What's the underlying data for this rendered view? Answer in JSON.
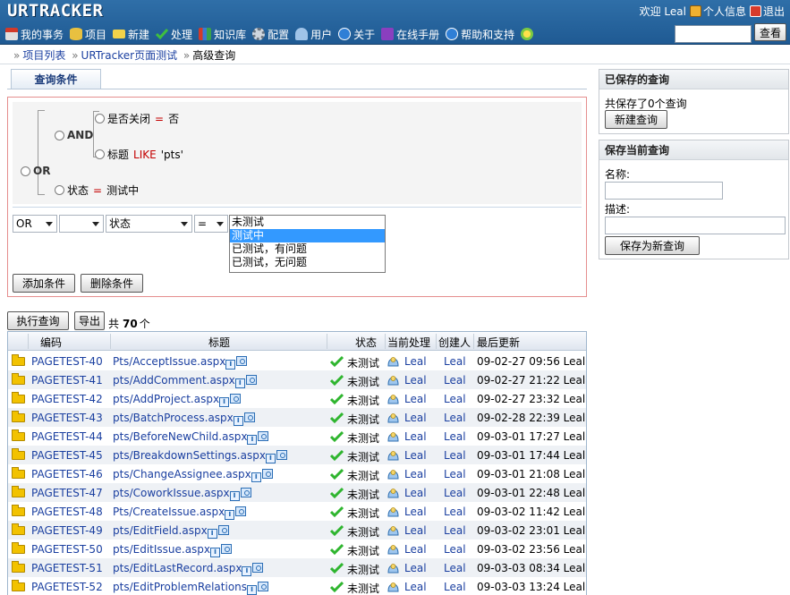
{
  "app": {
    "logo": "URTRACKER",
    "welcome": "欢迎 Leal",
    "profile_label": "个人信息",
    "logout_label": "退出"
  },
  "nav": [
    {
      "label": "我的事务",
      "icon": "home-icon"
    },
    {
      "label": "项目",
      "icon": "database-icon"
    },
    {
      "label": "新建",
      "icon": "new-icon"
    },
    {
      "label": "处理",
      "icon": "check-icon"
    },
    {
      "label": "知识库",
      "icon": "books-icon"
    },
    {
      "label": "配置",
      "icon": "gear-icon"
    },
    {
      "label": "用户",
      "icon": "users-icon"
    },
    {
      "label": "关于",
      "icon": "info-icon"
    },
    {
      "label": "在线手册",
      "icon": "book-icon"
    },
    {
      "label": "帮助和支持",
      "icon": "help-icon"
    }
  ],
  "search": {
    "value": "",
    "button": "查看"
  },
  "breadcrumb": [
    "项目列表",
    "URTracker页面测试",
    "高级查询"
  ],
  "tab_label": "查询条件",
  "tree": {
    "or_label": "OR",
    "and_label": "AND",
    "cond1": {
      "field": "是否关闭",
      "op": "=",
      "value": "否"
    },
    "cond2": {
      "field": "标题",
      "op": "LIKE",
      "value": "'pts'"
    },
    "cond3": {
      "field": "状态",
      "op": "=",
      "value": "测试中"
    }
  },
  "builder": {
    "logic": "OR",
    "bracket": "",
    "field": "状态",
    "operator": "=",
    "options": [
      "未测试",
      "测试中",
      "已测试，有问题",
      "已测试，无问题"
    ],
    "selected_index": 1,
    "add_button": "添加条件",
    "delete_button": "删除条件"
  },
  "saved": {
    "title": "已保存的查询",
    "summary": "共保存了0个查询",
    "new_button": "新建查询"
  },
  "save_current": {
    "title": "保存当前查询",
    "name_label": "名称:",
    "desc_label": "描述:",
    "name_value": "",
    "desc_value": "",
    "save_button": "保存为新查询"
  },
  "results": {
    "run_button": "执行查询",
    "export_button": "导出",
    "count_prefix": "共",
    "count": "70",
    "count_suffix": "个",
    "columns": [
      "编码",
      "标题",
      "状态",
      "当前处理",
      "创建人",
      "最后更新"
    ],
    "rows": [
      {
        "id": "PAGETEST-40",
        "title": "Pts/AcceptIssue.aspx",
        "status": "未测试",
        "assignee": "Leal",
        "creator": "Leal",
        "updated": "09-02-27 09:56 Leal"
      },
      {
        "id": "PAGETEST-41",
        "title": "pts/AddComment.aspx",
        "status": "未测试",
        "assignee": "Leal",
        "creator": "Leal",
        "updated": "09-02-27 21:22 Leal"
      },
      {
        "id": "PAGETEST-42",
        "title": "pts/AddProject.aspx",
        "status": "未测试",
        "assignee": "Leal",
        "creator": "Leal",
        "updated": "09-02-27 23:32 Leal"
      },
      {
        "id": "PAGETEST-43",
        "title": "pts/BatchProcess.aspx",
        "status": "未测试",
        "assignee": "Leal",
        "creator": "Leal",
        "updated": "09-02-28 22:39 Leal"
      },
      {
        "id": "PAGETEST-44",
        "title": "pts/BeforeNewChild.aspx",
        "status": "未测试",
        "assignee": "Leal",
        "creator": "Leal",
        "updated": "09-03-01 17:27 Leal"
      },
      {
        "id": "PAGETEST-45",
        "title": "pts/BreakdownSettings.aspx",
        "status": "未测试",
        "assignee": "Leal",
        "creator": "Leal",
        "updated": "09-03-01 17:44 Leal"
      },
      {
        "id": "PAGETEST-46",
        "title": "pts/ChangeAssignee.aspx",
        "status": "未测试",
        "assignee": "Leal",
        "creator": "Leal",
        "updated": "09-03-01 21:08 Leal"
      },
      {
        "id": "PAGETEST-47",
        "title": "pts/CoworkIssue.aspx",
        "status": "未测试",
        "assignee": "Leal",
        "creator": "Leal",
        "updated": "09-03-01 22:48 Leal"
      },
      {
        "id": "PAGETEST-48",
        "title": "Pts/CreateIssue.aspx",
        "status": "未测试",
        "assignee": "Leal",
        "creator": "Leal",
        "updated": "09-03-02 11:42 Leal"
      },
      {
        "id": "PAGETEST-49",
        "title": "pts/EditField.aspx",
        "status": "未测试",
        "assignee": "Leal",
        "creator": "Leal",
        "updated": "09-03-02 23:01 Leal"
      },
      {
        "id": "PAGETEST-50",
        "title": "pts/EditIssue.aspx",
        "status": "未测试",
        "assignee": "Leal",
        "creator": "Leal",
        "updated": "09-03-02 23:56 Leal"
      },
      {
        "id": "PAGETEST-51",
        "title": "pts/EditLastRecord.aspx",
        "status": "未测试",
        "assignee": "Leal",
        "creator": "Leal",
        "updated": "09-03-03 08:34 Leal"
      },
      {
        "id": "PAGETEST-52",
        "title": "pts/EditProblemRelations",
        "status": "未测试",
        "assignee": "Leal",
        "creator": "Leal",
        "updated": "09-03-03 13:24 Leal"
      }
    ]
  }
}
